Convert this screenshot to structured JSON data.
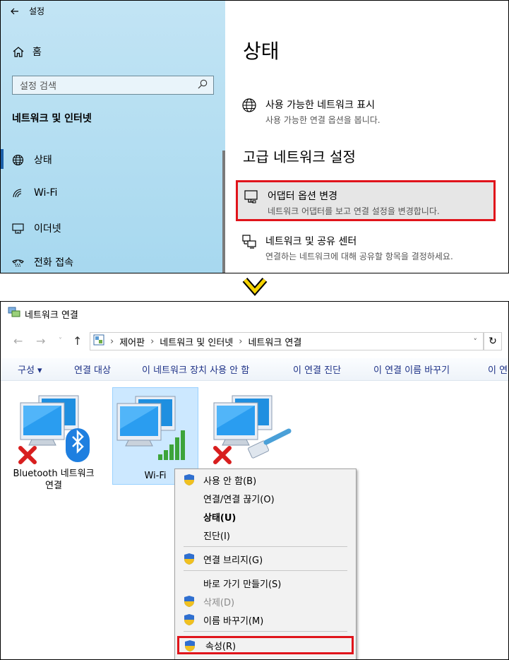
{
  "settings": {
    "window_title": "설정",
    "home_label": "홈",
    "search_placeholder": "설정 검색",
    "category": "네트워크 및 인터넷",
    "nav": [
      {
        "label": "상태",
        "icon": "globe-icon"
      },
      {
        "label": "Wi-Fi",
        "icon": "wifi-icon"
      },
      {
        "label": "이더넷",
        "icon": "ethernet-icon"
      },
      {
        "label": "전화 접속",
        "icon": "dialup-icon"
      }
    ],
    "page_title": "상태",
    "options_top": {
      "title": "사용 가능한 네트워크 표시",
      "desc": "사용 가능한 연결 옵션을 봅니다."
    },
    "section_title": "고급 네트워크 설정",
    "adapter_option": {
      "title": "어댑터 옵션 변경",
      "desc": "네트워크 어댑터를 보고 연결 설정을 변경합니다."
    },
    "sharing_option": {
      "title": "네트워크 및 공유 센터",
      "desc": "연결하는 네트워크에 대해 공유할 항목을 결정하세요."
    }
  },
  "netwin": {
    "title": "네트워크 연결",
    "breadcrumb": [
      "제어판",
      "네트워크 및 인터넷",
      "네트워크 연결"
    ],
    "commands": [
      "구성 ▾",
      "연결 대상",
      "이 네트워크 장치 사용 안 함",
      "이 연결 진단",
      "이 연결 이름 바꾸기",
      "이 연"
    ],
    "connections": [
      {
        "label": "Bluetooth 네트워크 연결"
      },
      {
        "label": "Wi-Fi"
      },
      {
        "label": ""
      }
    ]
  },
  "context_menu": {
    "items": [
      {
        "label": "사용 안 함(B)",
        "shield": true
      },
      {
        "label": "연결/연결 끊기(O)",
        "shield": false
      },
      {
        "label": "상태(U)",
        "shield": false
      },
      {
        "label": "진단(I)",
        "shield": false
      },
      {
        "label": "연결 브리지(G)",
        "shield": true
      },
      {
        "label": "바로 가기 만들기(S)",
        "shield": false
      },
      {
        "label": "삭제(D)",
        "shield": true
      },
      {
        "label": "이름 바꾸기(M)",
        "shield": true
      },
      {
        "label": "속성(R)",
        "shield": true
      }
    ]
  },
  "colors": {
    "highlight": "#e0141b",
    "arrow": "#f5d300",
    "sidebar": "#b6dff2"
  }
}
